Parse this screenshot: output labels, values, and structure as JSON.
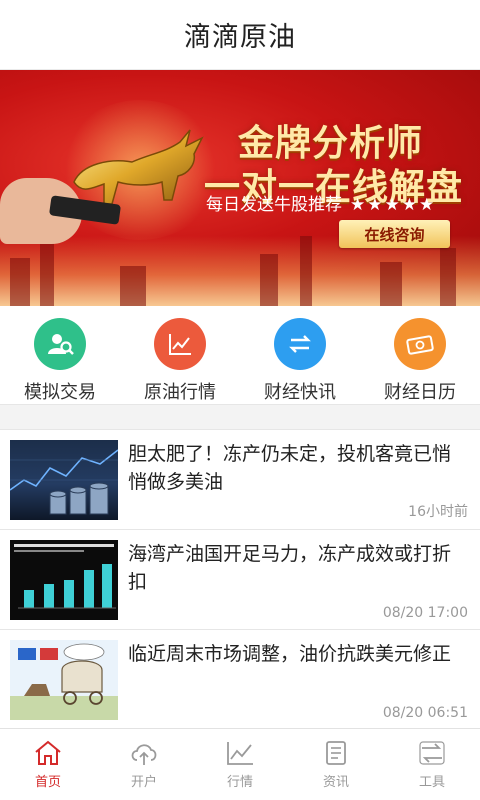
{
  "header": {
    "title": "滴滴原油"
  },
  "banner": {
    "headline_1": "金牌分析师",
    "headline_2": "一对一在线解盘",
    "subline": "每日发送牛股推荐",
    "stars": "★★★★★",
    "cta_label": "在线咨询"
  },
  "quick_menu": [
    {
      "label": "模拟交易",
      "color": "#2fc08a",
      "icon": "user-search-icon"
    },
    {
      "label": "原油行情",
      "color": "#ec5a3c",
      "icon": "chart-line-icon"
    },
    {
      "label": "财经快讯",
      "color": "#2d9ef0",
      "icon": "exchange-icon"
    },
    {
      "label": "财经日历",
      "color": "#f5922e",
      "icon": "money-icon"
    }
  ],
  "news": [
    {
      "title": "胆太肥了！冻产仍未定，投机客竟已悄悄做多美油",
      "time": "16小时前",
      "thumb": "oil-barrels-thumbnail"
    },
    {
      "title": "海湾产油国开足马力，冻产成效或打折扣",
      "time": "08/20 17:00",
      "thumb": "bar-chart-thumbnail"
    },
    {
      "title": "临近周末市场调整，油价抗跌美元修正",
      "time": "08/20 06:51",
      "thumb": "cartoon-thumbnail"
    }
  ],
  "tabbar": [
    {
      "label": "首页",
      "icon": "home-icon",
      "active": true
    },
    {
      "label": "开户",
      "icon": "cloud-upload-icon",
      "active": false
    },
    {
      "label": "行情",
      "icon": "market-chart-icon",
      "active": false
    },
    {
      "label": "资讯",
      "icon": "news-icon",
      "active": false
    },
    {
      "label": "工具",
      "icon": "tools-icon",
      "active": false
    }
  ],
  "colors": {
    "accent": "#d42a2a",
    "banner_red": "#c81414",
    "gold": "#ffe9a8"
  }
}
